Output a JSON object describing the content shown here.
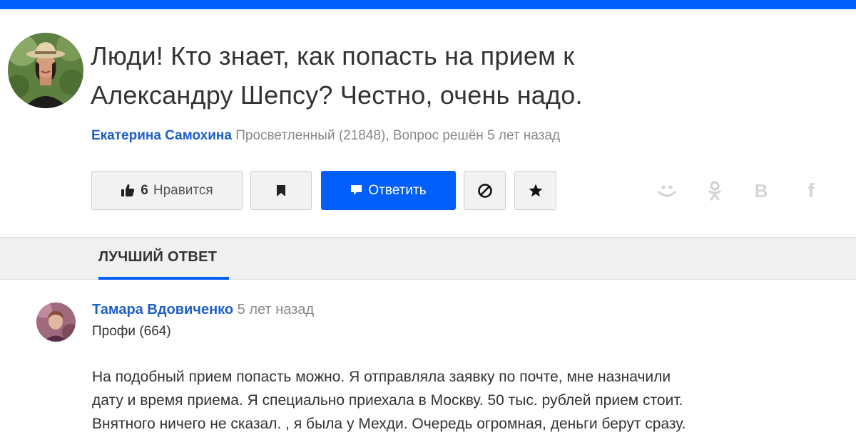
{
  "question": {
    "title_line1": "Люди! Кто знает, как попасть на прием к",
    "title_line2": "Александру Шепсу? Честно, очень надо.",
    "author": "Екатерина Самохина",
    "meta": " Просветленный (21848), Вопрос решён 5 лет назад"
  },
  "actions": {
    "like_count": "6",
    "like_label": "Нравится",
    "answer_label": "Ответить",
    "bookmark_icon": "bookmark-icon",
    "block_icon": "block-icon",
    "favorite_icon": "star-icon"
  },
  "share": {
    "icons": [
      "mymail-icon",
      "odnoklassniki-icon",
      "vk-icon",
      "facebook-icon"
    ],
    "vk_glyph": "В",
    "fb_glyph": "f"
  },
  "tabs": {
    "best_answer": "ЛУЧШИЙ ОТВЕТ"
  },
  "answer": {
    "author": "Тамара Вдовиченко",
    "time": " 5 лет назад",
    "rank": "Профи (664)",
    "line1": "На подобный прием попасть можно. Я отправляла заявку по почте, мне назначили",
    "line2": "дату и время приема. Я специально приехала в Москву. 50 тыс. рублей прием стоит.",
    "line3": "Внятного ничего не сказал. , я была у Мехди. Очередь огромная, деньги берут сразу."
  },
  "colors": {
    "accent": "#005ff9",
    "author_link": "#1d5ec7",
    "muted": "#888888",
    "button_bg": "#f2f2f2",
    "tab_bg": "#f0f0f0",
    "share_icon": "#d4d4d4"
  }
}
